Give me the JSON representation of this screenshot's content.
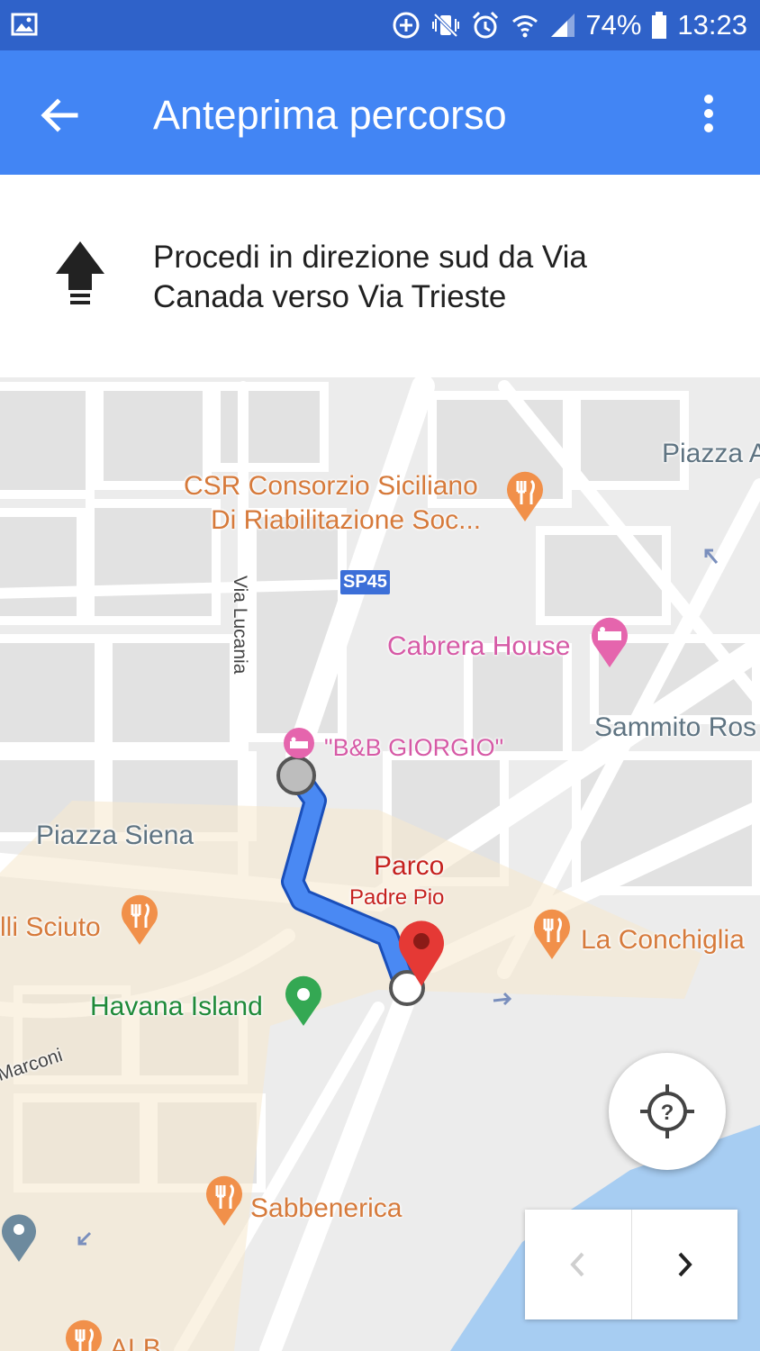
{
  "status_bar": {
    "battery_percent": "74%",
    "time": "13:23",
    "icons": [
      "image-icon",
      "data-saver-icon",
      "vibrate-icon",
      "alarm-icon",
      "wifi-icon",
      "signal-icon",
      "battery-icon"
    ]
  },
  "app_bar": {
    "title": "Anteprima percorso",
    "back_icon": "arrow-back-icon",
    "menu_icon": "more-vert-icon",
    "color": "#4285f4"
  },
  "direction": {
    "icon": "arrow-up-icon",
    "text_line1": "Procedi in direzione sud da Via",
    "text_line2": "Canada verso Via Trieste"
  },
  "map": {
    "route_color": "#4a89f3",
    "labels": {
      "csr_line1": "CSR Consorzio Siciliano",
      "csr_line2": "Di Riabilitazione Soc...",
      "piazza_a": "Piazza A",
      "sp45": "SP45",
      "via_lucania": "Via Lucania",
      "cabrera_house": "Cabrera House",
      "bb_giorgio": "\"B&B GIORGIO\"",
      "sammito": "Sammito Ros",
      "piazza_siena": "Piazza Siena",
      "parco": "Parco",
      "padre_pio": "Padre Pio",
      "la_conchiglia": "La Conchiglia",
      "sciuto": "lli Sciuto",
      "havana_island": "Havana Island",
      "marconi": "Marconi",
      "sabbenerica": "Sabbenerica",
      "alb": "ALB"
    }
  },
  "controls": {
    "locate_icon": "locate-unknown-icon",
    "prev_icon": "chevron-left-icon",
    "next_icon": "chevron-right-icon"
  }
}
